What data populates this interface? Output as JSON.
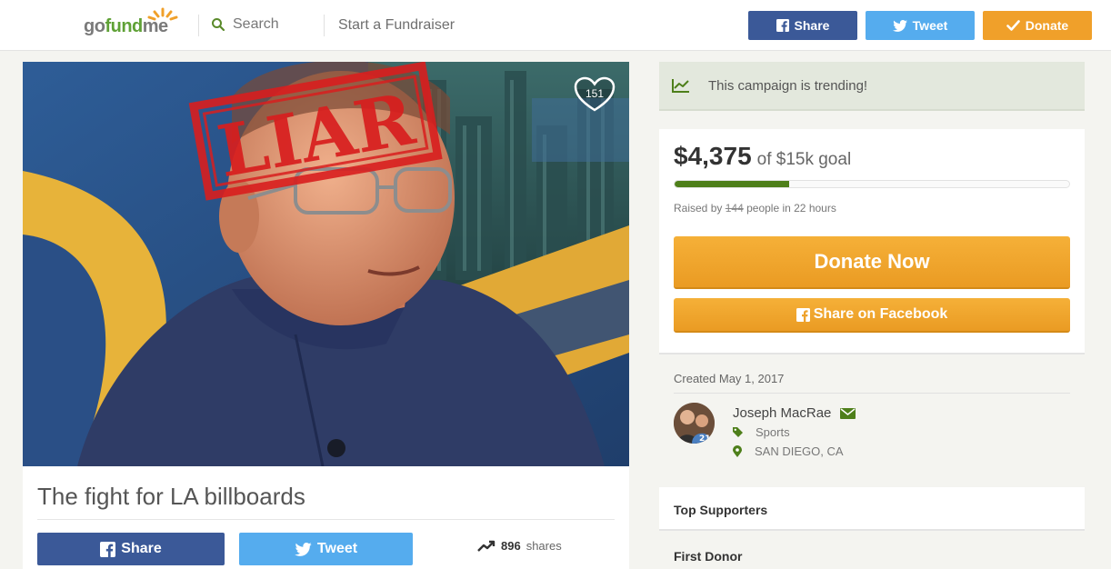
{
  "brand": {
    "logo_go": "go",
    "logo_fund": "fund",
    "logo_me": "me"
  },
  "header": {
    "search_label": "Search",
    "start_label": "Start a Fundraiser",
    "share_label": "Share",
    "tweet_label": "Tweet",
    "donate_label": "Donate"
  },
  "campaign": {
    "title": "The fight for LA billboards",
    "heart_count": "151",
    "stamp_text": "LIAR",
    "share_label": "Share",
    "tweet_label": "Tweet",
    "shares_count": "896",
    "shares_label": "shares"
  },
  "sidebar": {
    "trending_text": "This campaign is trending!",
    "amount": "$4,375",
    "goal_text": "of $15k goal",
    "progress_fraction": 0.29,
    "raised_prefix": "Raised by",
    "raised_count": "144",
    "raised_suffix": "people in 22 hours",
    "donate_now_label": "Donate Now",
    "share_facebook_label": "Share on Facebook",
    "created_text": "Created May 1, 2017",
    "organizer_name": "Joseph MacRae",
    "category": "Sports",
    "location": "SAN DIEGO, CA",
    "top_supporters_label": "Top Supporters",
    "first_donor_label": "First Donor"
  },
  "colors": {
    "facebook": "#3b5998",
    "twitter": "#55acee",
    "donate": "#f0a02a",
    "brand_green": "#5fa136",
    "progress": "#4e7f1a"
  },
  "icons": {
    "header_share": "facebook-icon",
    "header_tweet": "twitter-icon",
    "header_donate": "check-icon",
    "trending": "trending-chart-icon",
    "organizer_contact": "envelope-icon",
    "category": "tag-icon",
    "location": "map-pin-icon"
  }
}
